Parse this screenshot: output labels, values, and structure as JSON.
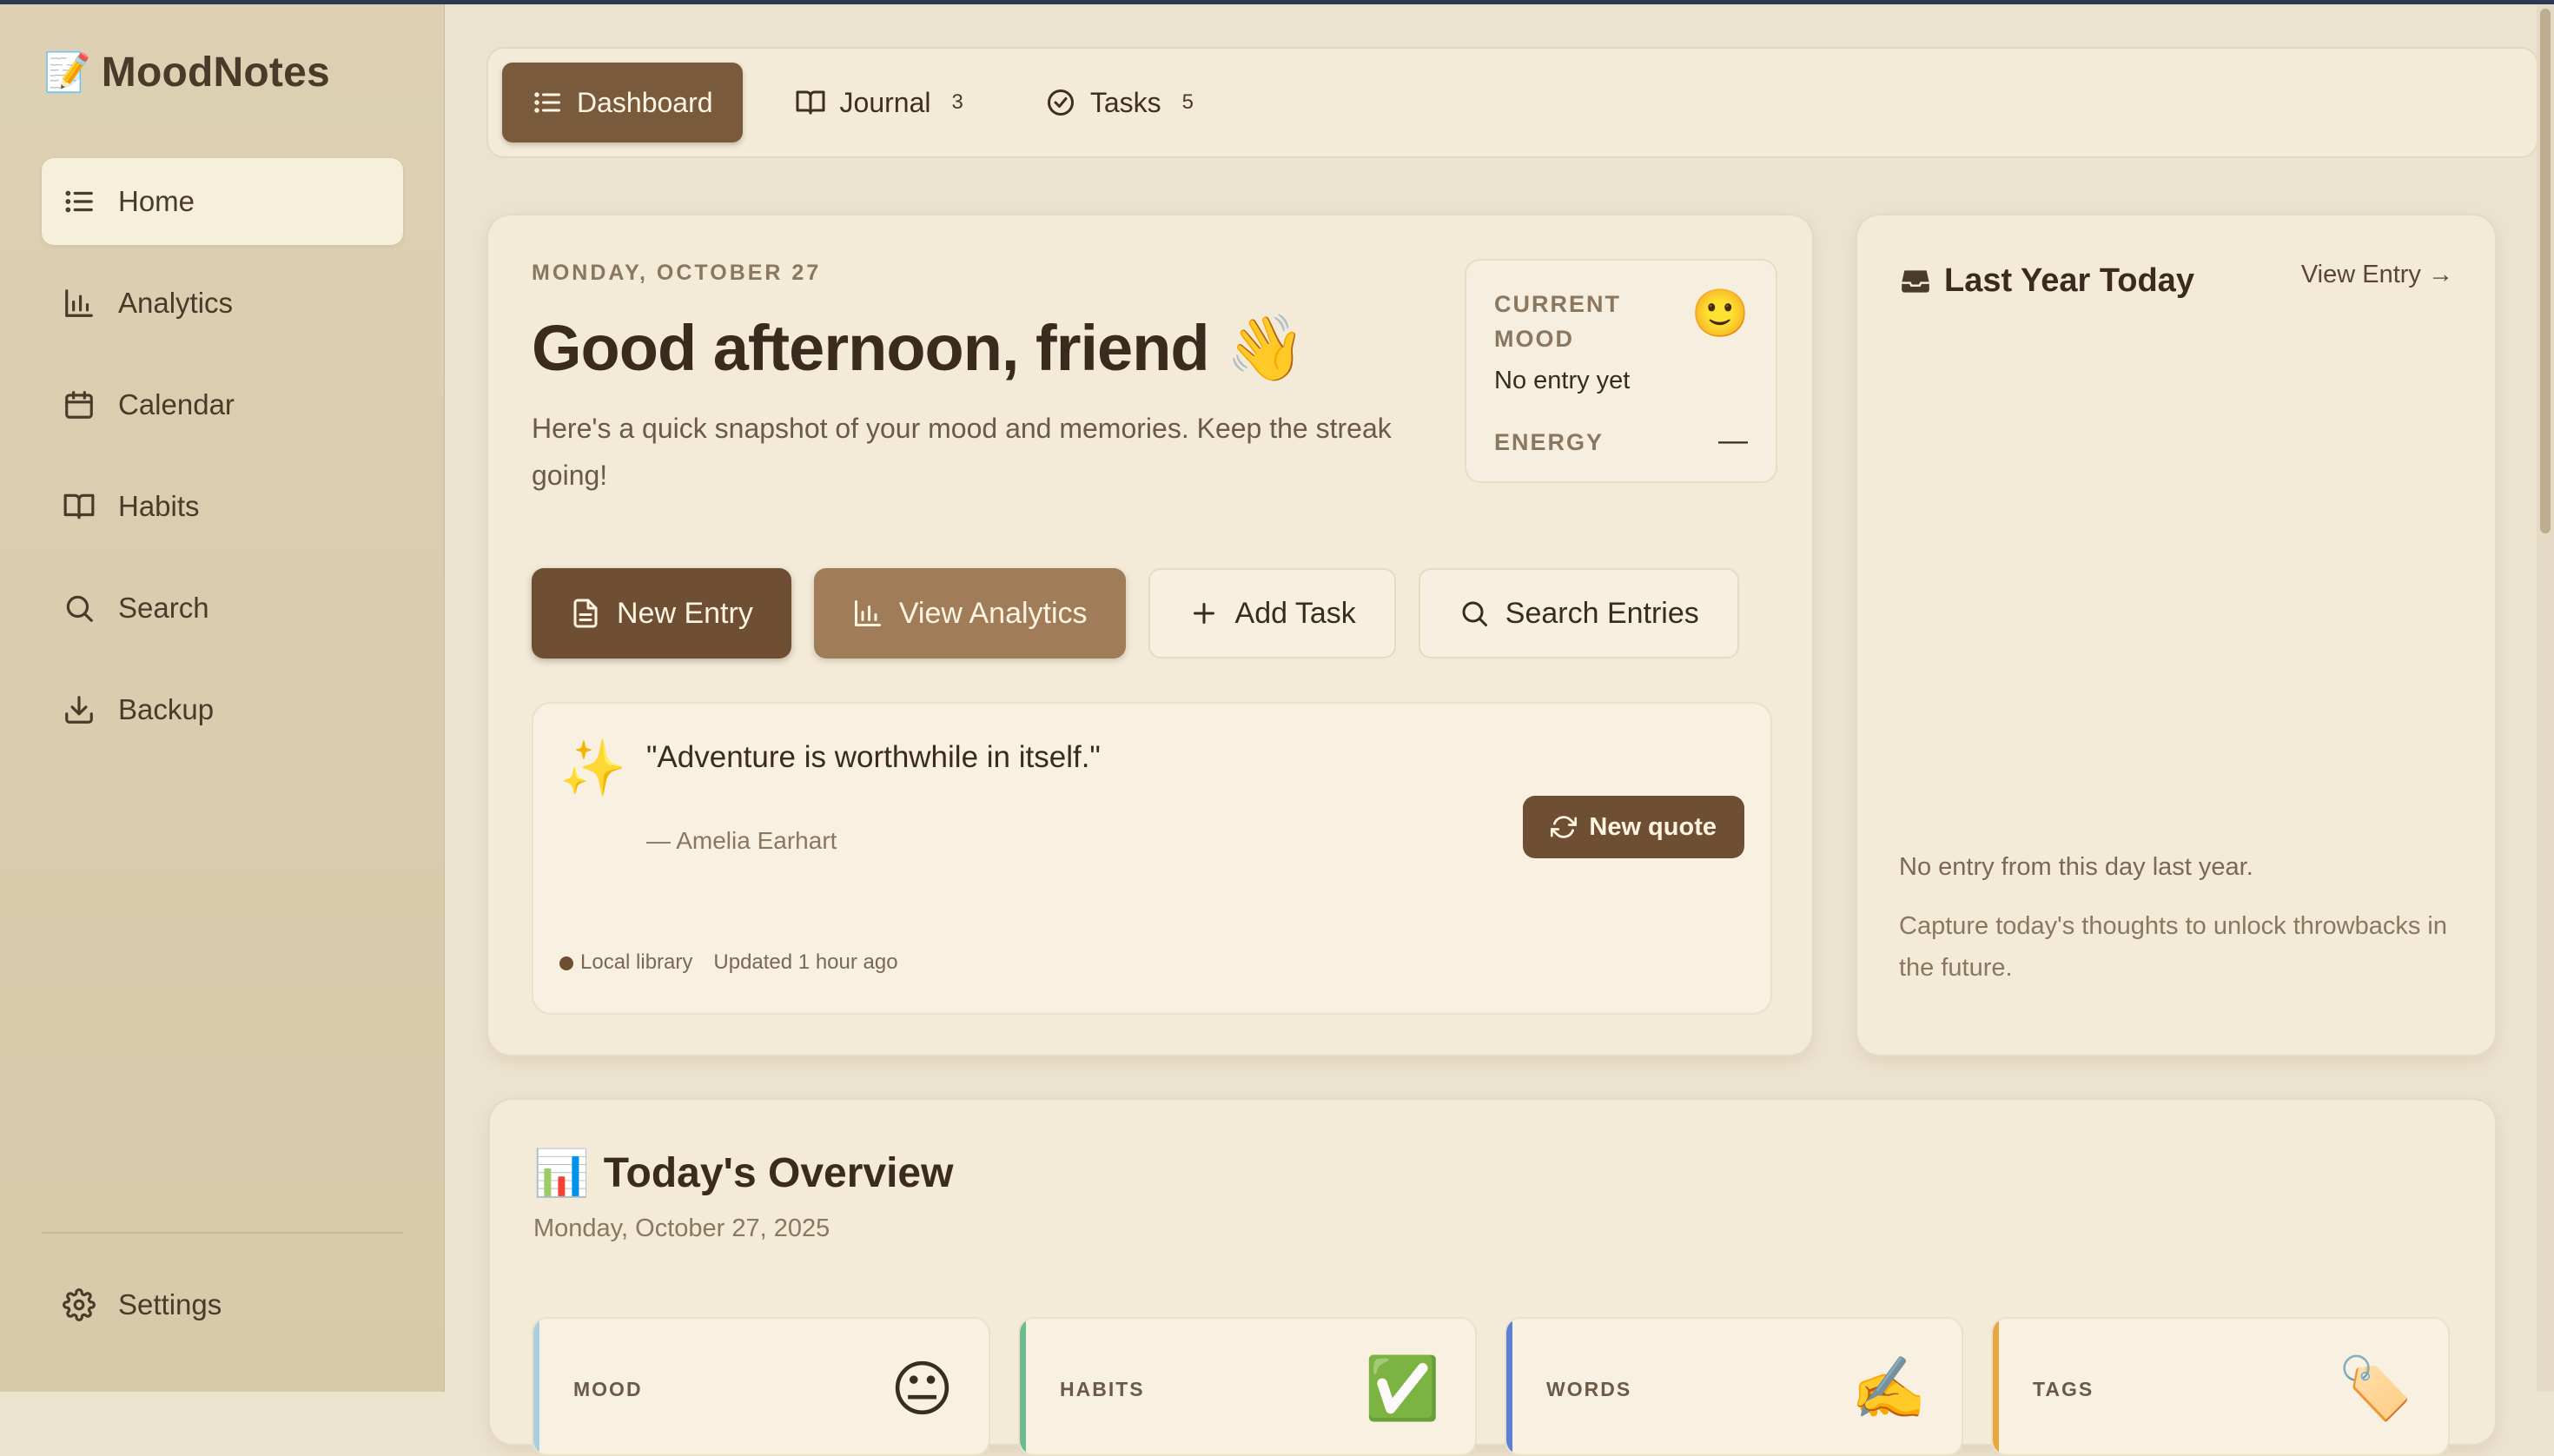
{
  "app": {
    "emoji": "📝",
    "name": "MoodNotes"
  },
  "sidebar": {
    "items": [
      {
        "label": "Home",
        "icon": "list-icon"
      },
      {
        "label": "Analytics",
        "icon": "bar-chart-icon"
      },
      {
        "label": "Calendar",
        "icon": "calendar-icon"
      },
      {
        "label": "Habits",
        "icon": "book-icon"
      },
      {
        "label": "Search",
        "icon": "search-icon"
      },
      {
        "label": "Backup",
        "icon": "download-icon"
      }
    ],
    "settings": {
      "label": "Settings",
      "icon": "gear-icon"
    }
  },
  "tabs": [
    {
      "label": "Dashboard",
      "count": "",
      "icon": "list-icon"
    },
    {
      "label": "Journal",
      "count": "3",
      "icon": "book-icon"
    },
    {
      "label": "Tasks",
      "count": "5",
      "icon": "check-circle-icon"
    }
  ],
  "hero": {
    "date": "MONDAY, OCTOBER 27",
    "greeting": "Good afternoon, friend 👋",
    "subtitle": "Here's a quick snapshot of your mood and memories. Keep the streak going!",
    "mood": {
      "label": "CURRENT MOOD",
      "face": "🙂",
      "value": "No entry yet",
      "energy_label": "ENERGY",
      "energy_value": "—"
    },
    "actions": {
      "new_entry": "New Entry",
      "view_analytics": "View Analytics",
      "add_task": "Add Task",
      "search_entries": "Search Entries"
    },
    "quote": {
      "sparkle": "✨",
      "text": "\"Adventure is worthwhile in itself.\"",
      "author": "— Amelia Earhart",
      "button": "New quote",
      "source": "Local library",
      "updated": "Updated 1 hour ago"
    }
  },
  "last_year": {
    "title": "Last Year Today",
    "link": "View Entry →",
    "empty": "No entry from this day last year.",
    "hint": "Capture today's thoughts to unlock throwbacks in the future."
  },
  "overview": {
    "emoji": "📊",
    "title": "Today's Overview",
    "date": "Monday, October 27, 2025",
    "stats": [
      {
        "label": "MOOD",
        "icon": "😐",
        "color": "#a9cfe0"
      },
      {
        "label": "HABITS",
        "icon": "✅",
        "color": "#6dbb8f"
      },
      {
        "label": "WORDS",
        "icon": "✍️",
        "color": "#5b7fd6"
      },
      {
        "label": "TAGS",
        "icon": "🏷️",
        "color": "#e6a640"
      }
    ]
  },
  "colors": {
    "accent": "#6e4f34",
    "background": "#ece3cf",
    "sidebar": "#d9cbad"
  }
}
